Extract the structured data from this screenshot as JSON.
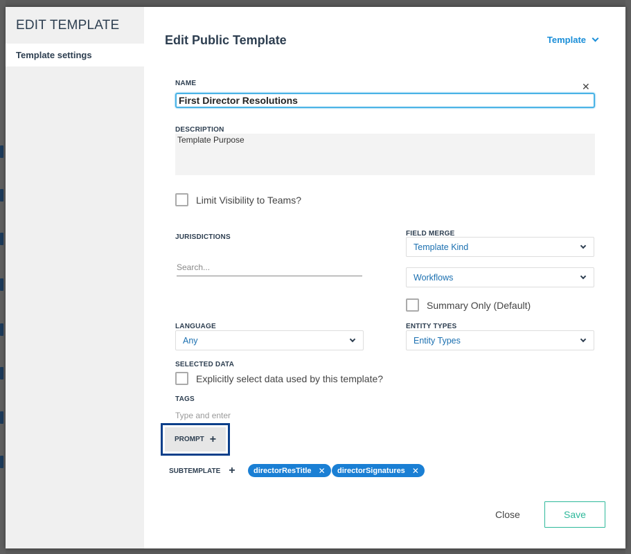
{
  "sidebar": {
    "title": "EDIT TEMPLATE",
    "items": [
      {
        "label": "Template settings"
      }
    ]
  },
  "header": {
    "title": "Edit Public Template",
    "menu_label": "Template"
  },
  "form": {
    "name": {
      "label": "NAME",
      "value": "First Director Resolutions"
    },
    "description": {
      "label": "DESCRIPTION",
      "value": "Template Purpose"
    },
    "limit_visibility": {
      "label": "Limit Visibility to Teams?",
      "checked": false
    },
    "jurisdictions": {
      "label": "JURISDICTIONS",
      "placeholder": "Search..."
    },
    "field_merge": {
      "label": "FIELD MERGE",
      "template_kind": "Template Kind",
      "workflows": "Workflows",
      "summary_only": {
        "label": "Summary Only (Default)",
        "checked": false
      }
    },
    "language": {
      "label": "LANGUAGE",
      "value": "Any"
    },
    "entity_types": {
      "label": "ENTITY TYPES",
      "value": "Entity Types"
    },
    "selected_data": {
      "label": "SELECTED DATA",
      "checkbox_label": "Explicitly select data used by this template?",
      "checked": false
    },
    "tags": {
      "label": "TAGS",
      "placeholder": "Type and enter"
    },
    "prompt": {
      "label": "PROMPT"
    },
    "subtemplate": {
      "label": "SUBTEMPLATE",
      "chips": [
        "directorResTitle",
        "directorSignatures"
      ]
    }
  },
  "footer": {
    "close_label": "Close",
    "save_label": "Save"
  },
  "colors": {
    "accent": "#1a8ed8",
    "chip": "#1a7fd4",
    "save": "#2db89a",
    "focus": "#0b3f8a"
  }
}
